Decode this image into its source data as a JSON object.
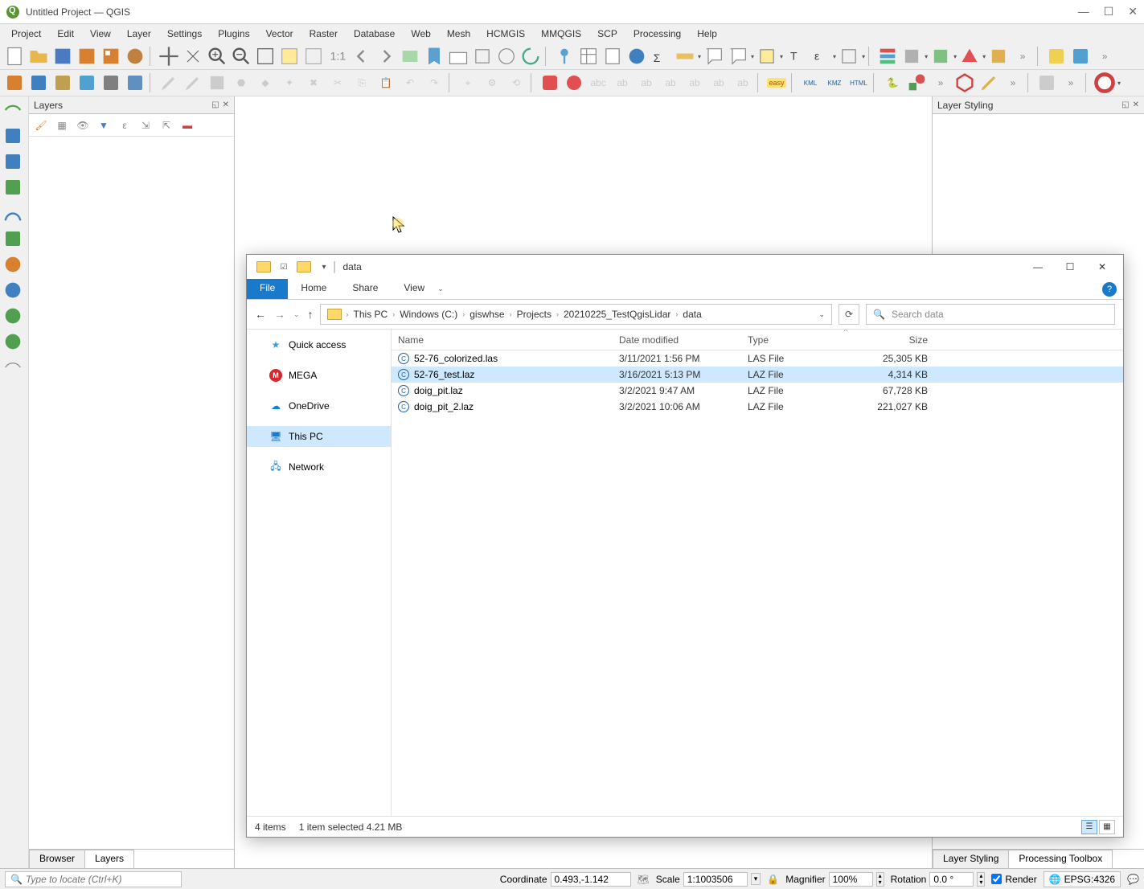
{
  "qgis": {
    "title": "Untitled Project — QGIS",
    "menu": [
      "Project",
      "Edit",
      "View",
      "Layer",
      "Settings",
      "Plugins",
      "Vector",
      "Raster",
      "Database",
      "Web",
      "Mesh",
      "HCMGIS",
      "MMQGIS",
      "SCP",
      "Processing",
      "Help"
    ],
    "layers_panel_title": "Layers",
    "layer_styling_title": "Layer Styling",
    "bottom_tabs": {
      "browser": "Browser",
      "layers": "Layers"
    },
    "right_tabs": {
      "layer_styling": "Layer Styling",
      "processing": "Processing Toolbox"
    },
    "locator_placeholder": "Type to locate (Ctrl+K)",
    "status": {
      "coordinate_label": "Coordinate",
      "coordinate_value": "0.493,-1.142",
      "scale_label": "Scale",
      "scale_value": "1:1003506",
      "magnifier_label": "Magnifier",
      "magnifier_value": "100%",
      "rotation_label": "Rotation",
      "rotation_value": "0.0 °",
      "render_label": "Render",
      "crs": "EPSG:4326"
    }
  },
  "explorer": {
    "window_title": "data",
    "ribbon_tabs": {
      "file": "File",
      "home": "Home",
      "share": "Share",
      "view": "View"
    },
    "breadcrumb": [
      "This PC",
      "Windows (C:)",
      "giswhse",
      "Projects",
      "20210225_TestQgisLidar",
      "data"
    ],
    "search_placeholder": "Search data",
    "nav_pane": [
      {
        "label": "Quick access",
        "icon": "star",
        "color": "#3b9be0"
      },
      {
        "label": "MEGA",
        "icon": "M",
        "color": "#d9272e"
      },
      {
        "label": "OneDrive",
        "icon": "cloud",
        "color": "#0a84d6"
      },
      {
        "label": "This PC",
        "icon": "pc",
        "color": "#2078c8",
        "selected": true
      },
      {
        "label": "Network",
        "icon": "net",
        "color": "#2078c8"
      }
    ],
    "columns": {
      "name": "Name",
      "date": "Date modified",
      "type": "Type",
      "size": "Size"
    },
    "files": [
      {
        "name": "52-76_colorized.las",
        "date": "3/11/2021 1:56 PM",
        "type": "LAS File",
        "size": "25,305 KB",
        "selected": false
      },
      {
        "name": "52-76_test.laz",
        "date": "3/16/2021 5:13 PM",
        "type": "LAZ File",
        "size": "4,314 KB",
        "selected": true
      },
      {
        "name": "doig_pit.laz",
        "date": "3/2/2021 9:47 AM",
        "type": "LAZ File",
        "size": "67,728 KB",
        "selected": false
      },
      {
        "name": "doig_pit_2.laz",
        "date": "3/2/2021 10:06 AM",
        "type": "LAZ File",
        "size": "221,027 KB",
        "selected": false
      }
    ],
    "status": {
      "items": "4 items",
      "selected": "1 item selected  4.21 MB"
    }
  }
}
